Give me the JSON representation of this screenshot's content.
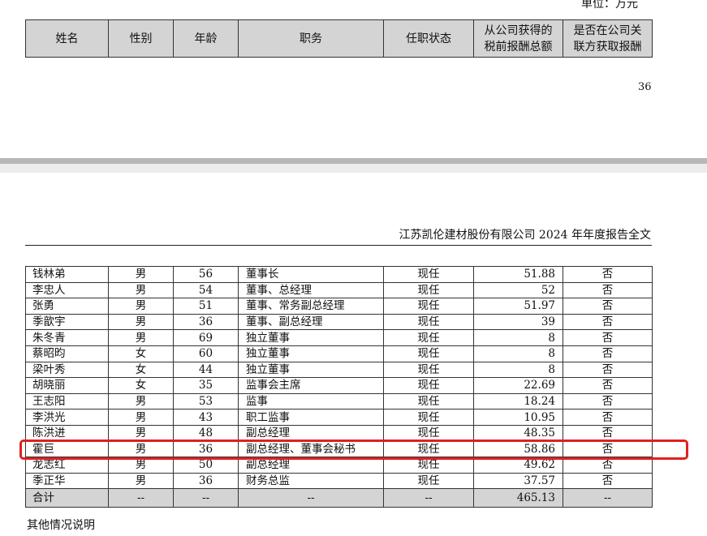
{
  "unit_label": "单位：万元",
  "header": {
    "name": "姓名",
    "gender": "性别",
    "age": "年龄",
    "position": "职务",
    "status": "任职状态",
    "pay_line1": "从公司获得的",
    "pay_line2": "税前报酬总额",
    "related_line1": "是否在公司关",
    "related_line2": "联方获取报酬"
  },
  "page_number": "36",
  "doc_header": "江苏凯伦建材股份有限公司 2024 年年度报告全文",
  "rows": [
    {
      "name": "钱林弟",
      "gender": "男",
      "age": "56",
      "position": "董事长",
      "status": "现任",
      "pay": "51.88",
      "related": "否"
    },
    {
      "name": "李忠人",
      "gender": "男",
      "age": "54",
      "position": "董事、总经理",
      "status": "现任",
      "pay": "52",
      "related": "否"
    },
    {
      "name": "张勇",
      "gender": "男",
      "age": "51",
      "position": "董事、常务副总经理",
      "status": "现任",
      "pay": "51.97",
      "related": "否"
    },
    {
      "name": "季歆宇",
      "gender": "男",
      "age": "36",
      "position": "董事、副总经理",
      "status": "现任",
      "pay": "39",
      "related": "否"
    },
    {
      "name": "朱冬青",
      "gender": "男",
      "age": "69",
      "position": "独立董事",
      "status": "现任",
      "pay": "8",
      "related": "否"
    },
    {
      "name": "蔡昭昀",
      "gender": "女",
      "age": "60",
      "position": "独立董事",
      "status": "现任",
      "pay": "8",
      "related": "否"
    },
    {
      "name": "梁叶秀",
      "gender": "女",
      "age": "44",
      "position": "独立董事",
      "status": "现任",
      "pay": "8",
      "related": "否"
    },
    {
      "name": "胡晓丽",
      "gender": "女",
      "age": "35",
      "position": "监事会主席",
      "status": "现任",
      "pay": "22.69",
      "related": "否"
    },
    {
      "name": "王志阳",
      "gender": "男",
      "age": "53",
      "position": "监事",
      "status": "现任",
      "pay": "18.24",
      "related": "否"
    },
    {
      "name": "李洪光",
      "gender": "男",
      "age": "43",
      "position": "职工监事",
      "status": "现任",
      "pay": "10.95",
      "related": "否"
    },
    {
      "name": "陈洪进",
      "gender": "男",
      "age": "48",
      "position": "副总经理",
      "status": "现任",
      "pay": "48.35",
      "related": "否"
    },
    {
      "name": "霍巨",
      "gender": "男",
      "age": "36",
      "position": "副总经理、董事会秘书",
      "status": "现任",
      "pay": "58.86",
      "related": "否"
    },
    {
      "name": "龙志红",
      "gender": "男",
      "age": "50",
      "position": "副总经理",
      "status": "现任",
      "pay": "49.62",
      "related": "否"
    },
    {
      "name": "季正华",
      "gender": "男",
      "age": "36",
      "position": "财务总监",
      "status": "现任",
      "pay": "37.57",
      "related": "否"
    }
  ],
  "total": {
    "name": "合计",
    "gender": "--",
    "age": "--",
    "position": "--",
    "status": "--",
    "pay": "465.13",
    "related": "--"
  },
  "note_label": "其他情况说明",
  "highlight_color": "#e02020"
}
